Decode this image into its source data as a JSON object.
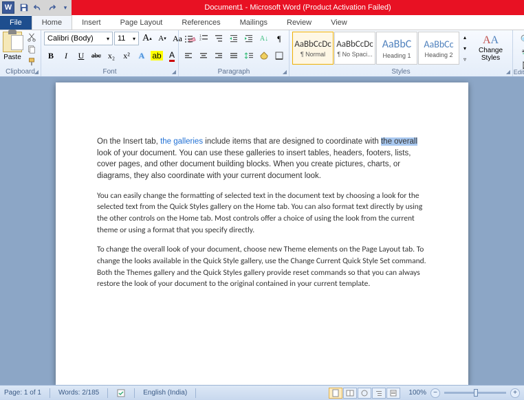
{
  "title": "Document1 - Microsoft Word (Product Activation Failed)",
  "tabs": {
    "file": "File",
    "home": "Home",
    "insert": "Insert",
    "pagelayout": "Page Layout",
    "references": "References",
    "mailings": "Mailings",
    "review": "Review",
    "view": "View"
  },
  "clipboard": {
    "paste": "Paste",
    "label": "Clipboard"
  },
  "font": {
    "name": "Calibri (Body)",
    "size": "11",
    "label": "Font",
    "grow": "A",
    "shrink": "A",
    "case": "Aa",
    "bold": "B",
    "italic": "I",
    "underline": "U",
    "strike": "abc",
    "sub": "x₂",
    "sup": "x²"
  },
  "para": {
    "label": "Paragraph"
  },
  "styles": {
    "label": "Styles",
    "items": [
      {
        "preview": "AaBbCcDc",
        "name": "¶ Normal"
      },
      {
        "preview": "AaBbCcDc",
        "name": "¶ No Spaci..."
      },
      {
        "preview": "AaBbC",
        "name": "Heading 1"
      },
      {
        "preview": "AaBbCc",
        "name": "Heading 2"
      }
    ],
    "change": "Change Styles"
  },
  "editing": {
    "label": "Editing"
  },
  "doc": {
    "p1_a": "On the Insert tab, ",
    "p1_link": "the galleries",
    "p1_b": " include items that are designed to coordinate with ",
    "p1_hl": "the overall",
    "p1_c": " look of your document. You can use these galleries to insert tables, headers, footers, lists, cover pages, and other document building blocks. When you create pictures, charts, or diagrams, they also coordinate with your current document look.",
    "p2": "You can easily change the formatting of selected text in the document text by choosing a look for the selected text from the Quick Styles gallery on the Home tab. You can also format text directly by using the other controls on the Home tab. Most controls offer a choice of using the look from the current theme or using a format that you specify directly.",
    "p3": "To change the overall look of your document, choose new Theme elements on the Page Layout tab. To change the looks available in the Quick Style gallery, use the Change Current Quick Style Set command. Both the Themes gallery and the Quick Styles gallery provide reset commands so that you can always restore the look of your document to the original contained in your current template."
  },
  "status": {
    "page": "Page: 1 of 1",
    "words": "Words: 2/185",
    "lang": "English (India)",
    "zoom": "100%"
  }
}
